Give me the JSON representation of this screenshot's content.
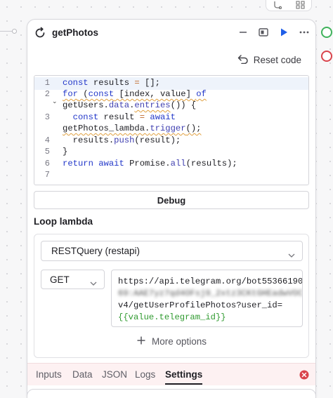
{
  "node": {
    "title": "getPhotos",
    "reset_label": "Reset code"
  },
  "editor": {
    "line_numbers": [
      "1",
      "2",
      "3",
      "4",
      "5",
      "6",
      "7"
    ],
    "lines": [
      "const results = [];",
      "for (const [index, value] of",
      "getUsers.data.entries()) {",
      "  const result = await",
      "getPhotos_lambda.trigger();",
      "  results.push(result);",
      "}",
      "return await Promise.all(results);"
    ]
  },
  "debug_label": "Debug",
  "loop_section_label": "Loop lambda",
  "loop": {
    "resource_value": "RESTQuery (restapi)",
    "method_value": "GET",
    "url_lines": [
      "https://api.telegram.org/bot55366190",
      "69:AAE7yz7qd4OFsj9_2xtz3CKtGHEadwVOC",
      "v4/getUserProfilePhotos?user_id=",
      "{{value.telegram_id}}"
    ],
    "more_options_label": "More options"
  },
  "tabs": [
    {
      "label": "Inputs"
    },
    {
      "label": "Data"
    },
    {
      "label": "JSON"
    },
    {
      "label": "Logs"
    },
    {
      "label": "Settings"
    }
  ],
  "active_tab": "Settings",
  "colors": {
    "accent_blue": "#1f5ee8",
    "keyword_blue": "#2237c9",
    "status_green": "#3fb25b",
    "status_red": "#d9434b",
    "tab_bar_bg": "#fdf1f2"
  },
  "icons": [
    "loop-icon",
    "minimize-icon",
    "panel-icon",
    "play-icon",
    "more-icon",
    "reset-icon",
    "chevron-down-icon",
    "plus-icon",
    "error-icon"
  ]
}
